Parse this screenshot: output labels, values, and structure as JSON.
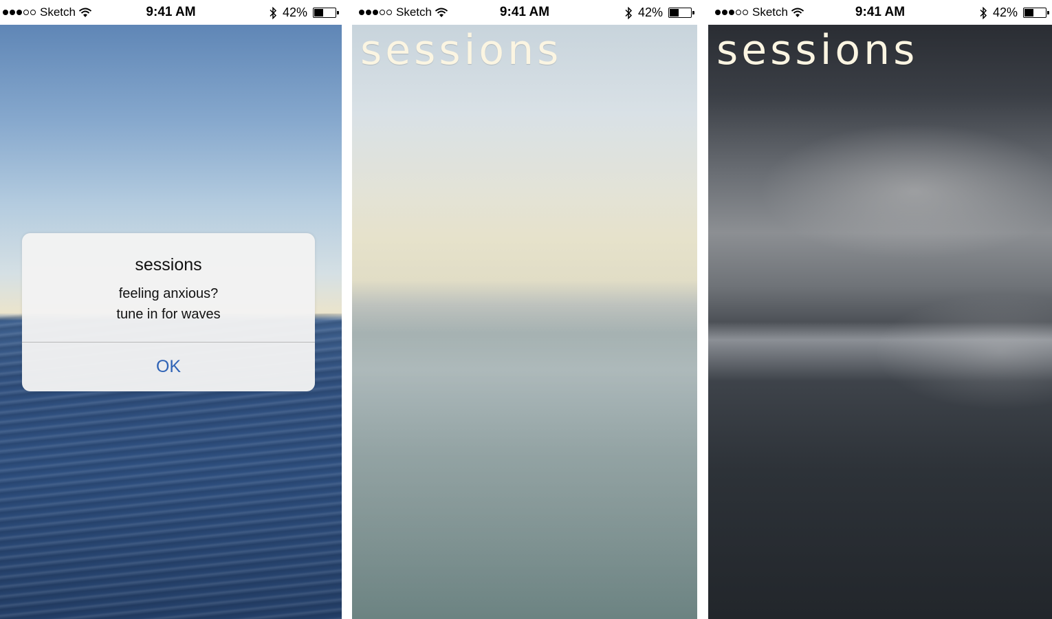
{
  "screens": [
    {
      "status_bar": {
        "carrier": "Sketch",
        "time": "9:41 AM",
        "battery": "42%",
        "battery_level": 0.42,
        "signal_bars": 3
      },
      "alert": {
        "title": "sessions",
        "message_line_1": "feeling anxious?",
        "message_line_2": "tune in for waves",
        "button_label": "OK"
      }
    },
    {
      "status_bar": {
        "carrier": "Sketch",
        "time": "9:41 AM",
        "battery": "42%",
        "battery_level": 0.42,
        "signal_bars": 3
      },
      "wordmark": "sessions"
    },
    {
      "status_bar": {
        "carrier": "Sketch",
        "time": "9:41 AM",
        "battery": "42%",
        "battery_level": 0.42,
        "signal_bars": 3
      },
      "wordmark": "sessions"
    }
  ],
  "colors": {
    "wordmark": "#fbf5e2",
    "alert_button": "#2f63b6",
    "alert_background": "#f3f3f3"
  },
  "icons": [
    "signal-dots-icon",
    "wifi-icon",
    "bluetooth-icon",
    "battery-icon"
  ]
}
